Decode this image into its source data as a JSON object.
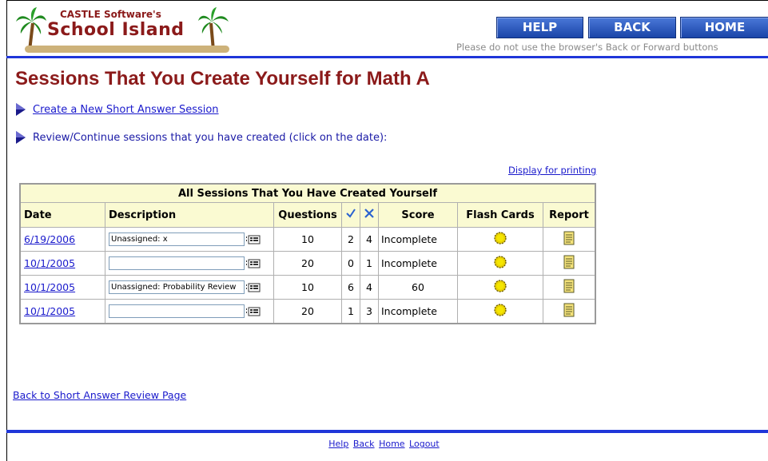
{
  "brand": {
    "top": "CASTLE Software's",
    "name": "School Island"
  },
  "nav": {
    "help": "HELP",
    "back": "BACK",
    "home": "HOME"
  },
  "notice": "Please do not use the browser's Back or Forward buttons",
  "title": "Sessions That You Create Yourself for Math A",
  "links": {
    "create": "Create a New Short Answer Session",
    "review": "Review/Continue sessions that you have created (click on the date):",
    "print": "Display for printing",
    "back_review": "Back to Short Answer Review Page"
  },
  "table": {
    "caption": "All Sessions That You Have Created Yourself",
    "headers": {
      "date": "Date",
      "description": "Description",
      "questions": "Questions",
      "correct": "✓",
      "wrong": "✕",
      "score": "Score",
      "flash": "Flash Cards",
      "report": "Report"
    },
    "rows": [
      {
        "date": "6/19/2006",
        "description": "Unassigned: x",
        "questions": "10",
        "correct": "2",
        "wrong": "4",
        "score": "Incomplete"
      },
      {
        "date": "10/1/2005",
        "description": "",
        "questions": "20",
        "correct": "0",
        "wrong": "1",
        "score": "Incomplete"
      },
      {
        "date": "10/1/2005",
        "description": "Unassigned: Probability Review",
        "questions": "10",
        "correct": "6",
        "wrong": "4",
        "score": "60"
      },
      {
        "date": "10/1/2005",
        "description": "",
        "questions": "20",
        "correct": "1",
        "wrong": "3",
        "score": "Incomplete"
      }
    ]
  },
  "footer": {
    "help": "Help",
    "back": "Back",
    "home": "Home",
    "logout": "Logout"
  },
  "colors": {
    "title": "#8b1a1a",
    "rule": "#1f36d9",
    "button": "#2a55c0",
    "header_bg": "#fafad2"
  }
}
